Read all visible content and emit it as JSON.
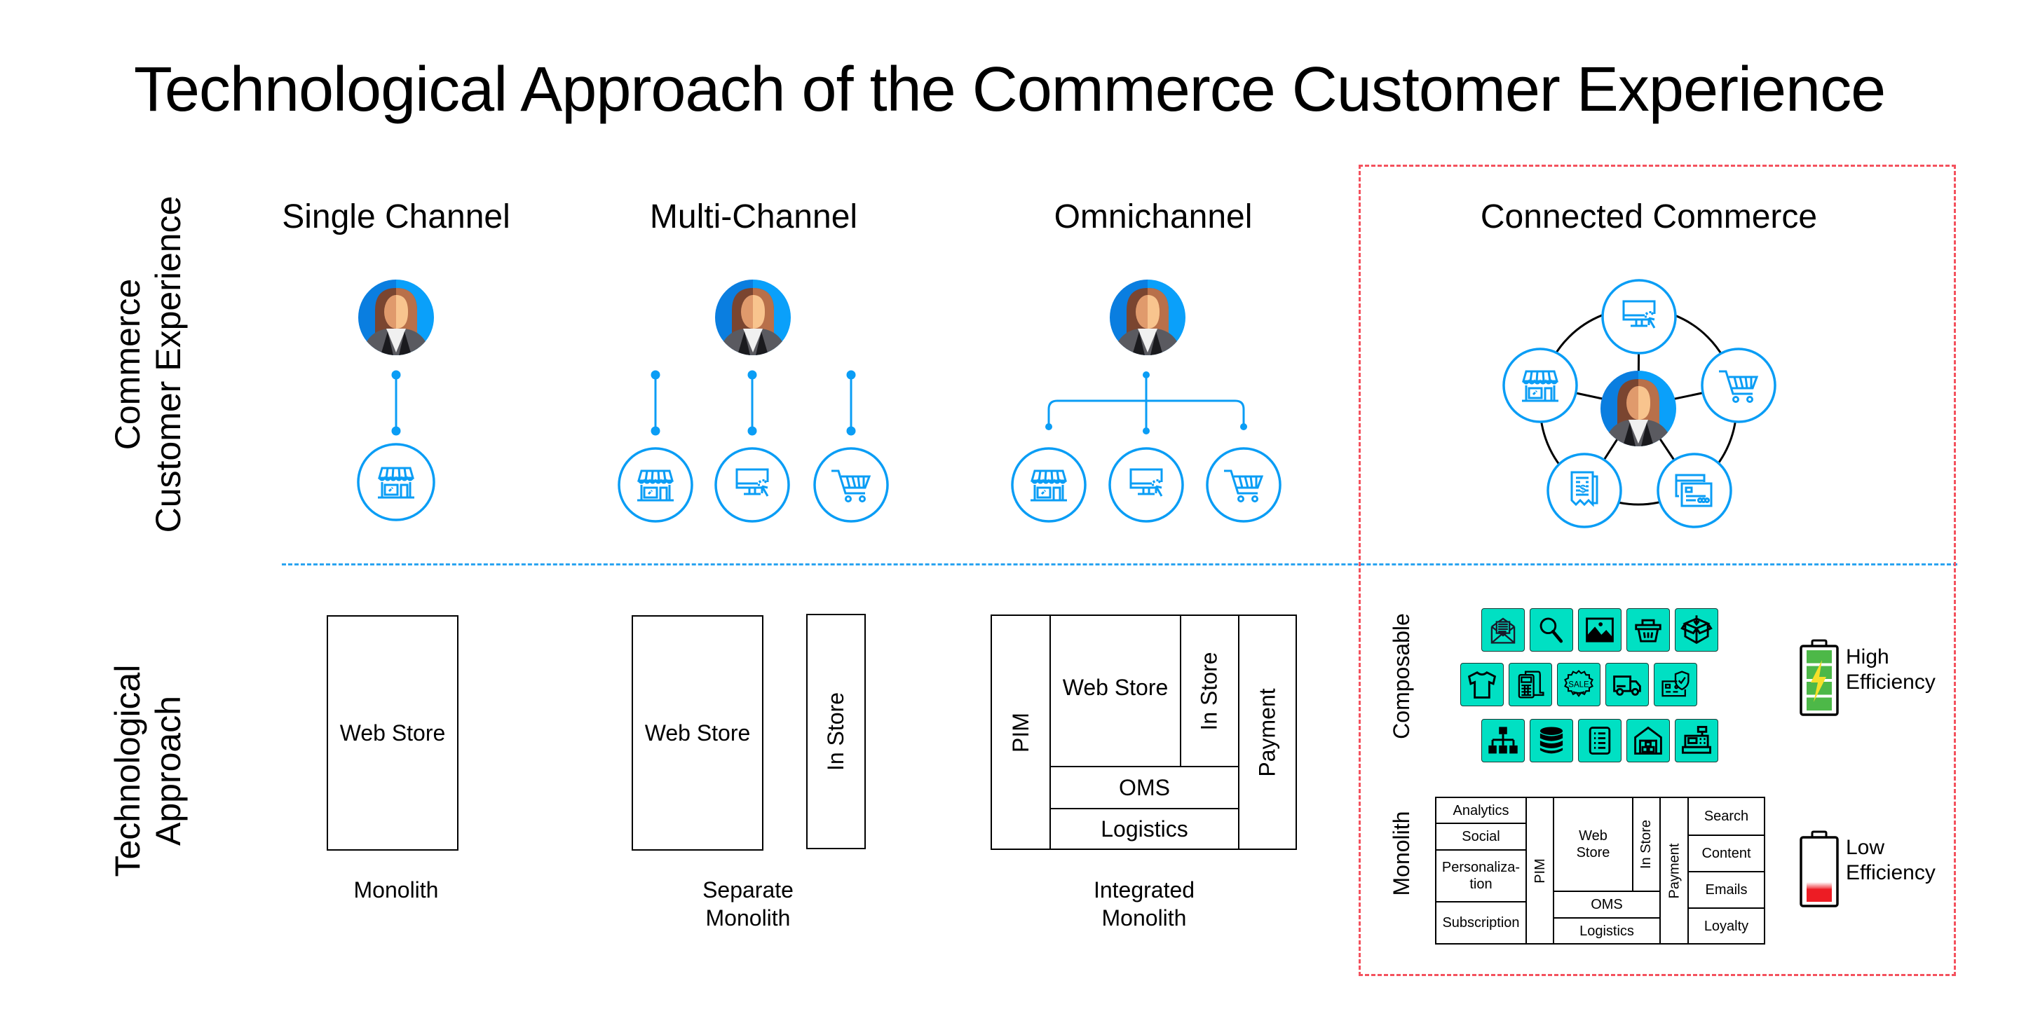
{
  "title": "Technological Approach of the Commerce Customer Experience",
  "row_labels": {
    "top": [
      "Commerce",
      "Customer Experience"
    ],
    "bottom": [
      "Technological",
      "Approach"
    ]
  },
  "columns": [
    {
      "heading": "Single Channel",
      "tech_caption": [
        "Monolith"
      ],
      "channels": [
        "store-icon"
      ]
    },
    {
      "heading": "Multi-Channel",
      "tech_caption": [
        "Separate",
        "Monolith"
      ],
      "channels": [
        "store-icon",
        "computer-click-icon",
        "shopping-cart-icon"
      ]
    },
    {
      "heading": "Omnichannel",
      "tech_caption": [
        "Integrated",
        "Monolith"
      ],
      "channels": [
        "store-icon",
        "computer-click-icon",
        "shopping-cart-icon"
      ]
    },
    {
      "heading": "Connected Commerce",
      "channels": [
        "computer-click-icon",
        "shopping-cart-icon",
        "credit-cards-icon",
        "receipt-icon",
        "store-icon"
      ]
    }
  ],
  "single_monolith": {
    "web_store": "Web Store"
  },
  "separate_monolith": {
    "web_store": "Web Store",
    "in_store": "In Store"
  },
  "integrated_monolith": {
    "pim": "PIM",
    "web_store": "Web Store",
    "in_store": "In Store",
    "oms": "OMS",
    "logistics": "Logistics",
    "payment": "Payment"
  },
  "connected": {
    "composable_label": "Composable",
    "monolith_label": "Monolith",
    "composable_tiles": [
      [
        "email-newsletter-icon",
        "search-icon",
        "image-icon",
        "basket-icon",
        "box-icon"
      ],
      [
        "tshirt-icon",
        "pos-terminal-icon",
        "sale-badge-icon",
        "delivery-truck-icon",
        "secure-card-icon"
      ],
      [
        "sitemap-icon",
        "database-icon",
        "list-document-icon",
        "warehouse-icon",
        "cash-register-icon"
      ]
    ],
    "monolith_grid": {
      "left": [
        "Analytics",
        "Social",
        "Personaliza-\ntion",
        "Subscription"
      ],
      "pim": "PIM",
      "web_store": "Web\nStore",
      "in_store": "In Store",
      "oms": "OMS",
      "logistics": "Logistics",
      "payment": "Payment",
      "right": [
        "Search",
        "Content",
        "Emails",
        "Loyalty"
      ]
    },
    "efficiency": [
      {
        "label": [
          "High",
          "Efficiency"
        ],
        "level": 1.0,
        "color": "#4db848"
      },
      {
        "label": [
          "Low",
          "Efficiency"
        ],
        "level": 0.15,
        "color": "#ed1c24"
      }
    ]
  },
  "colors": {
    "accent_blue": "#0a9df5",
    "divider_blue": "#2aa4f0",
    "highlight_red": "#f4525e",
    "tile_teal": "#00e0c3"
  }
}
